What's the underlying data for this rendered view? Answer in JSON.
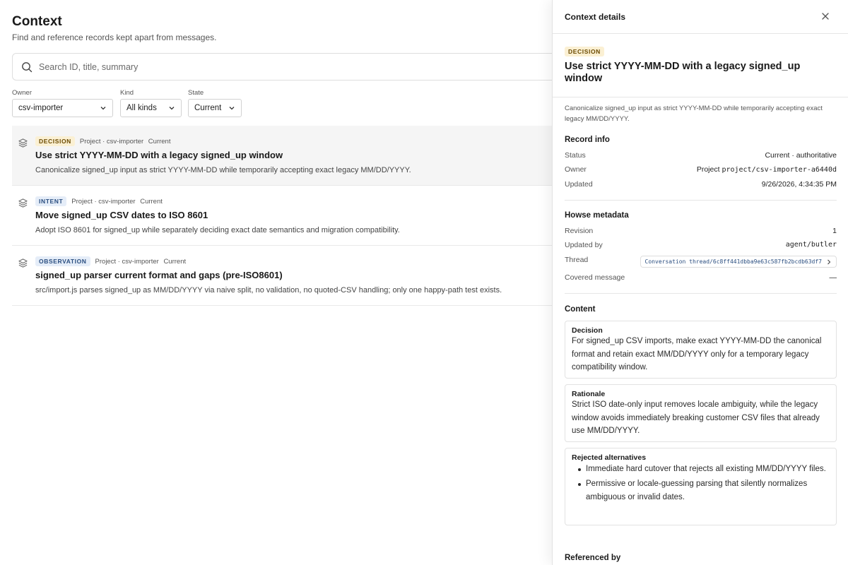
{
  "page": {
    "title": "Context",
    "subtitle": "Find and reference records kept apart from messages."
  },
  "search": {
    "placeholder": "Search ID, title, summary",
    "icon": "search-icon"
  },
  "filters": {
    "owner": {
      "label": "Owner",
      "value": "csv-importer"
    },
    "kind": {
      "label": "Kind",
      "value": "All kinds"
    },
    "state": {
      "label": "State",
      "value": "Current"
    }
  },
  "records": [
    {
      "badge": "DECISION",
      "scope": "Project · csv-importer",
      "state": "Current",
      "title": "Use strict YYYY-MM-DD with a legacy signed_up window",
      "summary": "Canonicalize signed_up input as strict YYYY-MM-DD while temporarily accepting exact legacy MM/DD/YYYY.",
      "selected": true
    },
    {
      "badge": "INTENT",
      "scope": "Project · csv-importer",
      "state": "Current",
      "title": "Move signed_up CSV dates to ISO 8601",
      "summary": "Adopt ISO 8601 for signed_up while separately deciding exact date semantics and migration compatibility.",
      "selected": false
    },
    {
      "badge": "OBSERVATION",
      "scope": "Project · csv-importer",
      "state": "Current",
      "title": "signed_up parser current format and gaps (pre-ISO8601)",
      "summary": "src/import.js parses signed_up as MM/DD/YYYY via naive split, no validation, no quoted-CSV handling; only one happy-path test exists.",
      "selected": false
    }
  ],
  "panel": {
    "header": "Context details",
    "badge": "DECISION",
    "title": "Use strict YYYY-MM-DD with a legacy signed_up window",
    "summary": "Canonicalize signed_up input as strict YYYY-MM-DD while temporarily accepting exact legacy MM/DD/YYYY.",
    "record_info": {
      "title": "Record info",
      "status_label": "Status",
      "status_value": "Current · authoritative",
      "owner_label": "Owner",
      "owner_prefix": "Project",
      "owner_value": "project/csv-importer-a6440d",
      "updated_label": "Updated",
      "updated_value": "9/26/2026, 4:34:35 PM"
    },
    "metadata": {
      "title": "Howse metadata",
      "revision_label": "Revision",
      "revision_value": "1",
      "updated_by_label": "Updated by",
      "updated_by_value": "agent/butler",
      "thread_label": "Thread",
      "thread_value": "Conversation thread/6c8ff441dbba9e63c587fb2bcdb63df7",
      "covered_label": "Covered message",
      "covered_value": "—"
    },
    "content": {
      "title": "Content",
      "decision_title": "Decision",
      "decision_text": "For signed_up CSV imports, make exact YYYY-MM-DD the canonical format and retain exact MM/DD/YYYY only for a temporary legacy compatibility window.",
      "rationale_title": "Rationale",
      "rationale_text": "Strict ISO date-only input removes locale ambiguity, while the legacy window avoids immediately breaking customer CSV files that already use MM/DD/YYYY.",
      "rejected_title": "Rejected alternatives",
      "rejected_items": [
        "Immediate hard cutover that rejects all existing MM/DD/YYYY files.",
        "Permissive or locale-guessing parsing that silently normalizes ambiguous or invalid dates."
      ]
    },
    "referenced_by": "Referenced by"
  }
}
